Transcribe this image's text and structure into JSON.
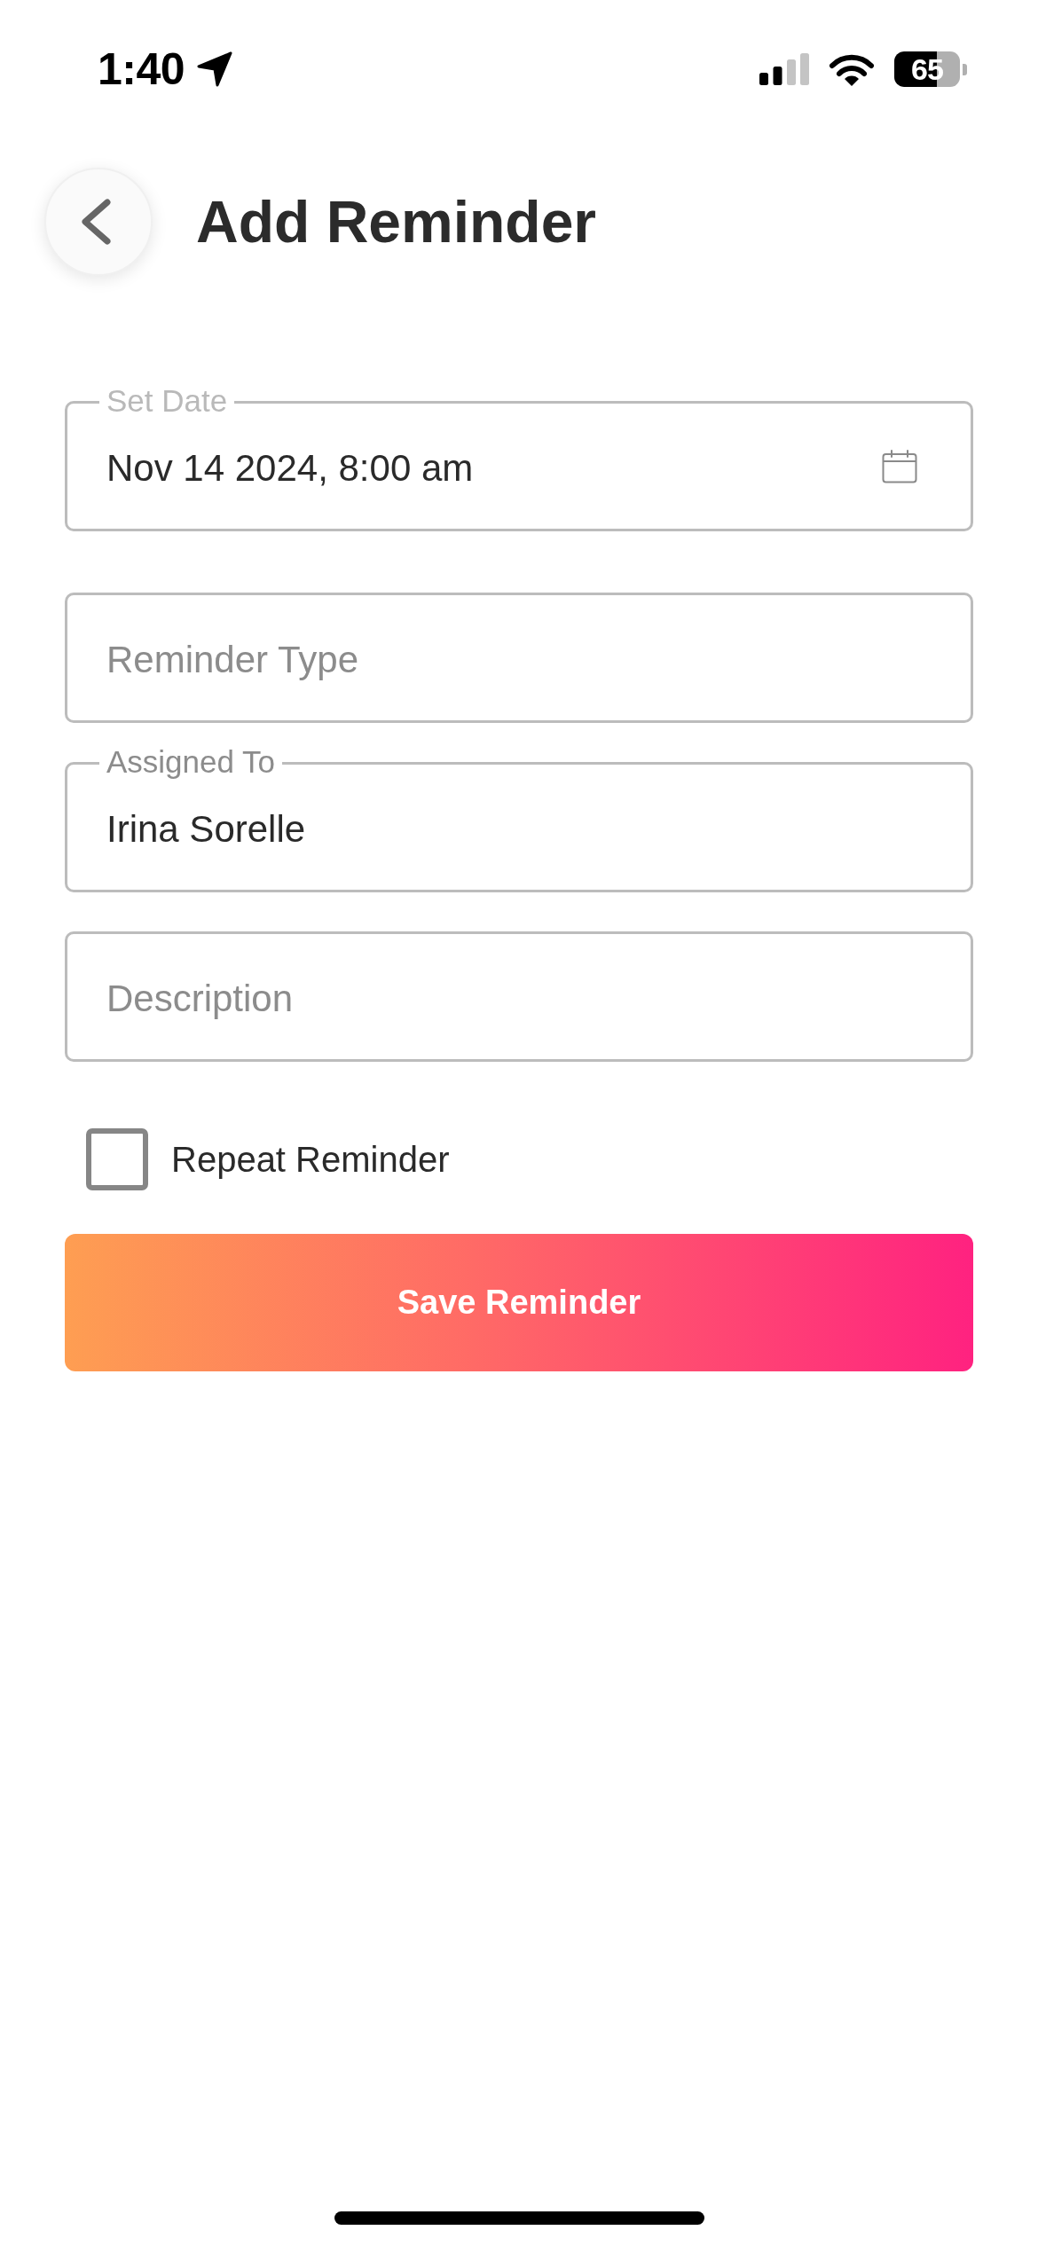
{
  "status_bar": {
    "time": "1:40",
    "battery": "65"
  },
  "header": {
    "title": "Add Reminder"
  },
  "form": {
    "fields": [
      {
        "kind": "date",
        "label": "Set Date",
        "value": "Nov 14 2024, 8:00 am"
      },
      {
        "kind": "text",
        "placeholder": "Reminder Type"
      },
      {
        "kind": "text",
        "label": "Assigned To",
        "value": "Irina Sorelle"
      },
      {
        "kind": "text",
        "placeholder": "Description"
      }
    ],
    "repeat": {
      "label": "Repeat Reminder",
      "checked": false
    }
  },
  "save_button": {
    "label": "Save Reminder"
  }
}
